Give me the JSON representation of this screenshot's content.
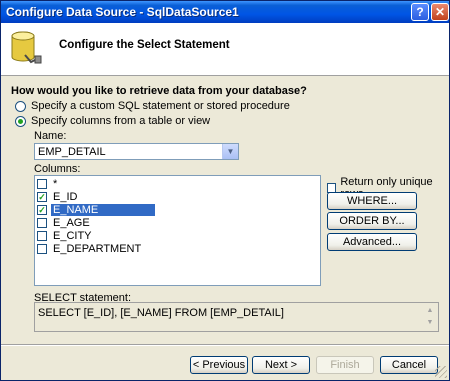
{
  "window": {
    "title": "Configure Data Source - SqlDataSource1"
  },
  "header": {
    "title": "Configure the Select Statement"
  },
  "question": "How would you like to retrieve data from your database?",
  "options": {
    "custom_sql": "Specify a custom SQL statement or stored procedure",
    "table_view": "Specify columns from a table or view"
  },
  "name_label": "Name:",
  "name_value": "EMP_DETAIL",
  "columns_label": "Columns:",
  "columns": [
    {
      "name": "*",
      "checked": false,
      "selected": false
    },
    {
      "name": "E_ID",
      "checked": true,
      "selected": false
    },
    {
      "name": "E_NAME",
      "checked": true,
      "selected": true
    },
    {
      "name": "E_AGE",
      "checked": false,
      "selected": false
    },
    {
      "name": "E_CITY",
      "checked": false,
      "selected": false
    },
    {
      "name": "E_DEPARTMENT",
      "checked": false,
      "selected": false
    }
  ],
  "unique_rows_label": "Return only unique rows",
  "buttons": {
    "where": "WHERE...",
    "order_by": "ORDER BY...",
    "advanced": "Advanced...",
    "previous": "< Previous",
    "next": "Next >",
    "finish": "Finish",
    "cancel": "Cancel"
  },
  "select_label": "SELECT statement:",
  "select_text": "SELECT [E_ID], [E_NAME] FROM [EMP_DETAIL]"
}
